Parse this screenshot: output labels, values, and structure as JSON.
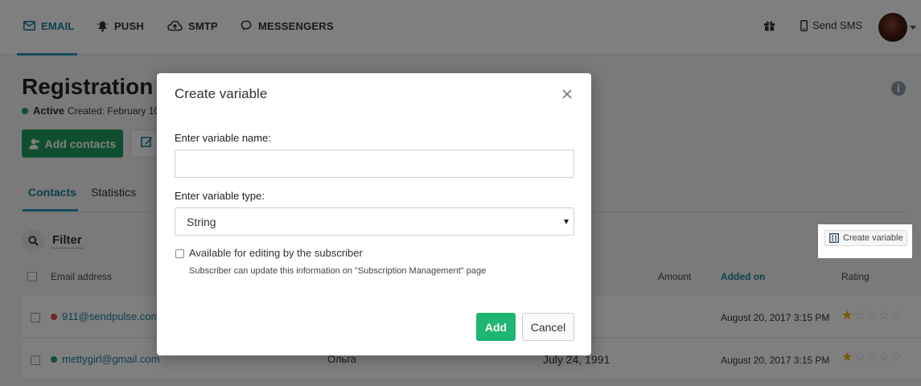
{
  "nav": {
    "items": [
      {
        "label": "EMAIL",
        "icon": "envelope-icon"
      },
      {
        "label": "PUSH",
        "icon": "bell-icon"
      },
      {
        "label": "SMTP",
        "icon": "cloud-upload-icon"
      },
      {
        "label": "MESSENGERS",
        "icon": "chat-bubble-icon"
      }
    ],
    "active": "EMAIL",
    "send_sms": "Send SMS",
    "accent_color": "#1a7e9e"
  },
  "page": {
    "title": "Registration",
    "status": "Active",
    "created": "Created: February 10,",
    "add_contacts": "Add contacts",
    "tabs": [
      "Contacts",
      "Statistics"
    ],
    "filter": "Filter",
    "create_variable": "Create variable"
  },
  "table": {
    "headers": {
      "email": "Email address",
      "amount": "Amount",
      "added_on": "Added on",
      "rating": "Rating"
    },
    "rows": [
      {
        "email": "911@sendpulse.com",
        "status_color": "#d9534f",
        "name": "",
        "date": "",
        "added_on": "August 20, 2017 3:15 PM",
        "rating": 1
      },
      {
        "email": "mettygirl@gmail.com",
        "status_color": "#1e9f5e",
        "name": "Ольга",
        "date": "July 24, 1991",
        "added_on": "August 20, 2017 3:15 PM",
        "rating": 1
      }
    ]
  },
  "modal": {
    "title": "Create variable",
    "name_label": "Enter variable name:",
    "name_value": "",
    "type_label": "Enter variable type:",
    "type_value": "String",
    "checkbox_label": "Available for editing by the subscriber",
    "checkbox_hint": "Subscriber can update this information on \"Subscription Management\" page",
    "add_button": "Add",
    "cancel_button": "Cancel"
  }
}
